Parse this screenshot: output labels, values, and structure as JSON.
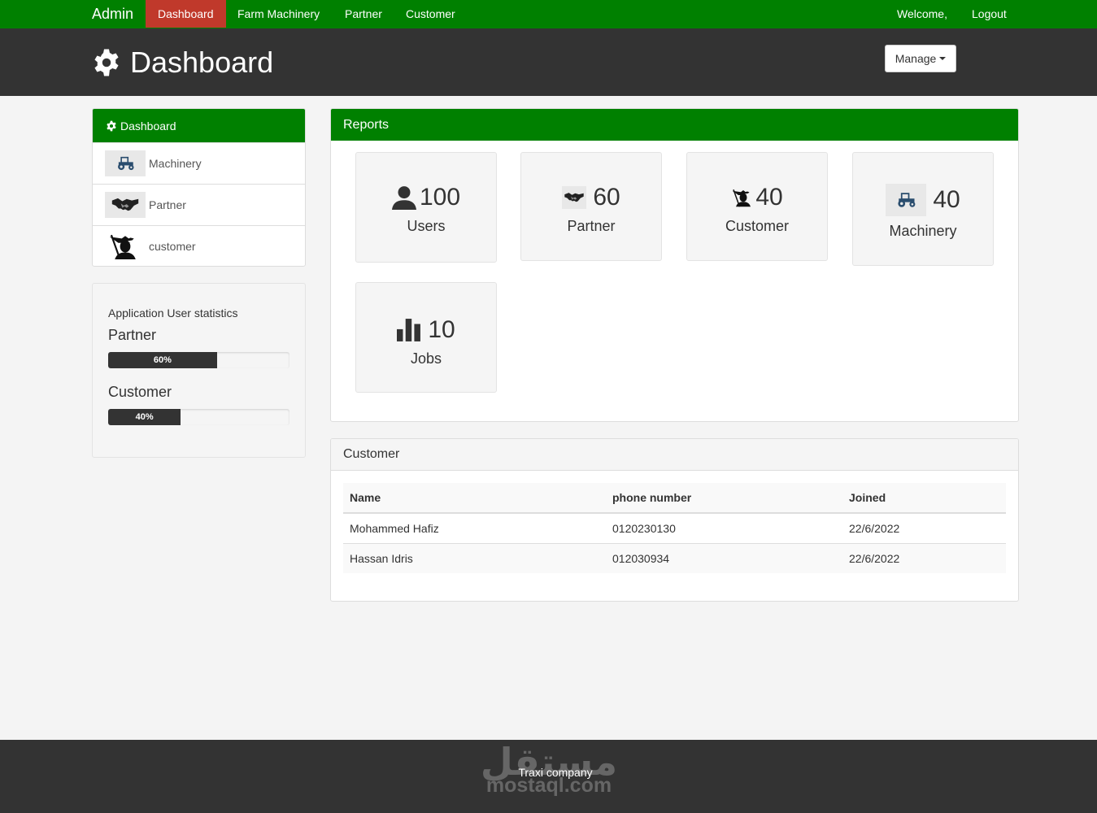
{
  "navbar": {
    "brand": "Admin",
    "items": [
      {
        "label": "Dashboard",
        "active": true
      },
      {
        "label": "Farm Machinery"
      },
      {
        "label": "Partner"
      },
      {
        "label": "Customer"
      }
    ],
    "welcome": "Welcome,",
    "logout": "Logout"
  },
  "header": {
    "title": "Dashboard",
    "icon": "gear-icon",
    "manage_label": "Manage"
  },
  "sidebar": {
    "title": "Dashboard",
    "items": [
      {
        "label": "Machinery",
        "icon": "tractor-icon"
      },
      {
        "label": "Partner",
        "icon": "handshake-icon"
      },
      {
        "label": "customer",
        "icon": "farmer-icon"
      }
    ]
  },
  "stats": {
    "title": "Application User statistics",
    "items": [
      {
        "label": "Partner",
        "percent": 60,
        "text": "60%"
      },
      {
        "label": "Customer",
        "percent": 40,
        "text": "40%"
      }
    ]
  },
  "reports": {
    "title": "Reports",
    "cards": [
      {
        "count": "100",
        "label": "Users",
        "icon": "user-icon"
      },
      {
        "count": "60",
        "label": "Partner",
        "icon": "handshake-icon"
      },
      {
        "count": "40",
        "label": "Customer",
        "icon": "farmer-icon"
      },
      {
        "count": "40",
        "label": "Machinery",
        "icon": "tractor-icon"
      },
      {
        "count": "10",
        "label": "Jobs",
        "icon": "bar-chart-icon"
      }
    ]
  },
  "customer": {
    "title": "Customer",
    "columns": [
      "Name",
      "phone number",
      "Joined"
    ],
    "rows": [
      [
        "Mohammed Hafiz",
        "0120230130",
        "22/6/2022"
      ],
      [
        "Hassan Idris",
        "012030934",
        "22/6/2022"
      ]
    ]
  },
  "footer": {
    "text": "Traxi company",
    "watermark_arabic": "مستقل",
    "watermark_latin": "mostaql.com"
  },
  "colors": {
    "brand_green": "#008000",
    "active_red": "#c0392b",
    "dark": "#333333"
  }
}
